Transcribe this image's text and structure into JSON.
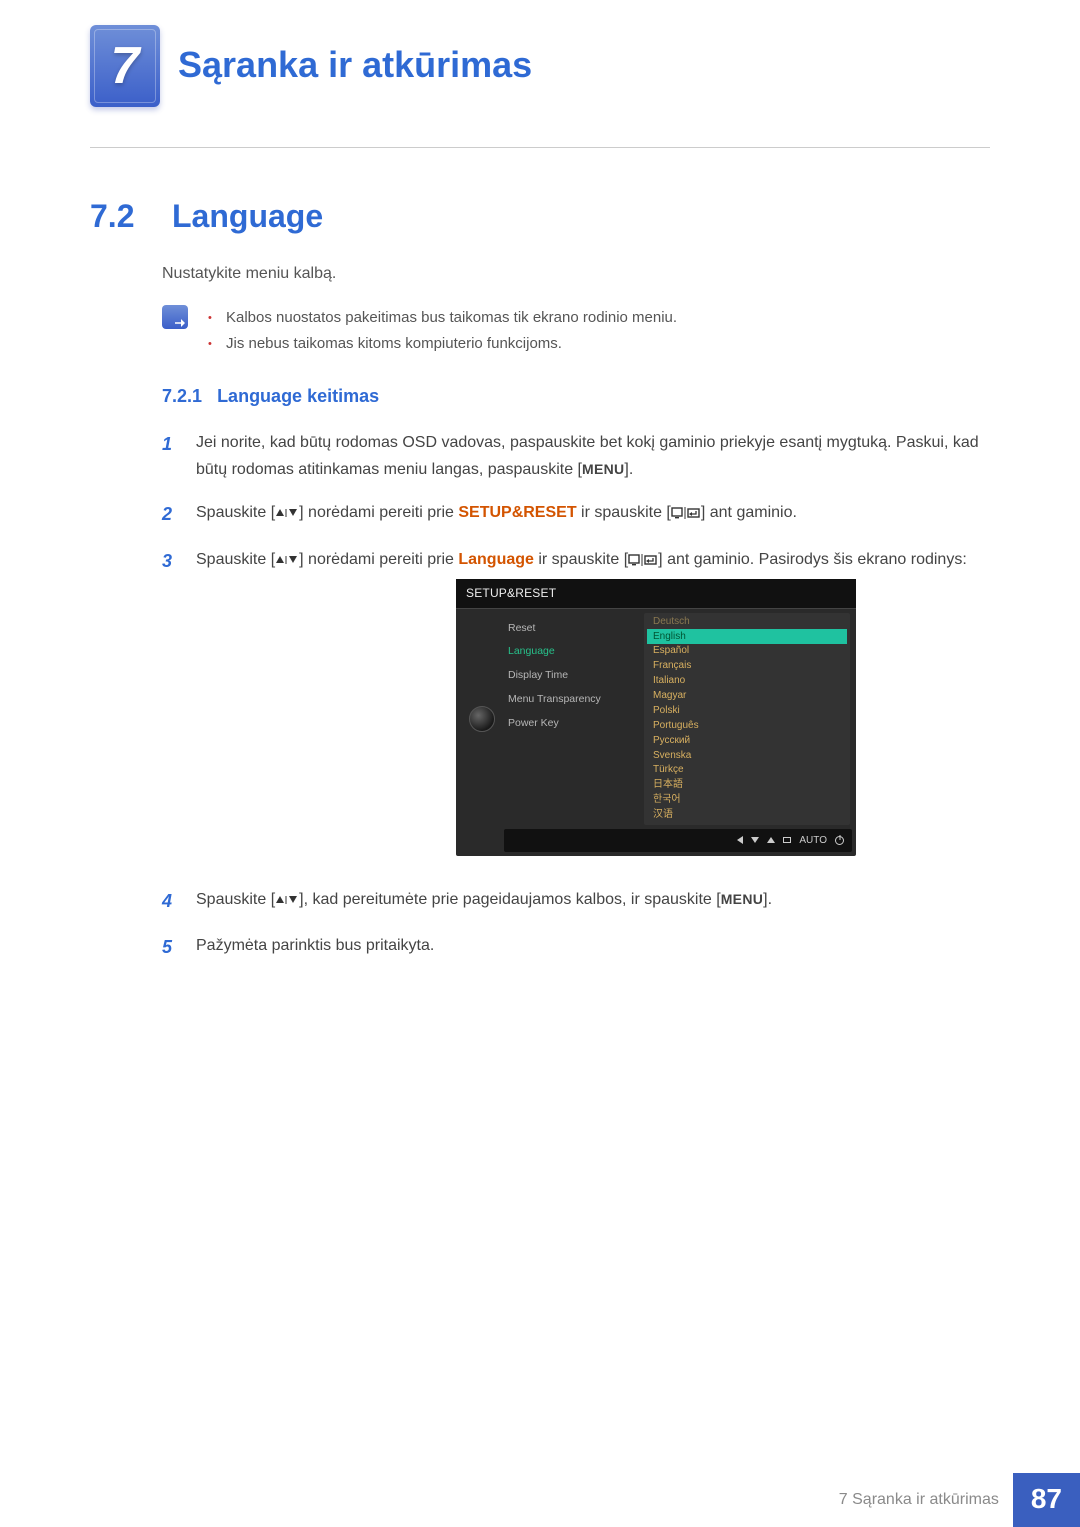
{
  "chapter": {
    "number": "7",
    "title": "Sąranka ir atkūrimas"
  },
  "section": {
    "number": "7.2",
    "title": "Language"
  },
  "intro": "Nustatykite meniu kalbą.",
  "notes": [
    "Kalbos nuostatos pakeitimas bus taikomas tik ekrano rodinio meniu.",
    "Jis nebus taikomas kitoms kompiuterio funkcijoms."
  ],
  "subsection": {
    "number": "7.2.1",
    "title": "Language keitimas"
  },
  "steps": {
    "s1a": "Jei norite, kad būtų rodomas OSD vadovas, paspauskite bet kokį gaminio priekyje esantį mygtuką. Paskui, kad būtų rodomas atitinkamas meniu langas, paspauskite [",
    "s1b": "].",
    "s2a": "Spauskite [",
    "s2b": "] norėdami pereiti prie ",
    "s2c": " ir spauskite [",
    "s2d": "] ant gaminio.",
    "s3a": "Spauskite [",
    "s3b": "] norėdami pereiti prie ",
    "s3c": " ir spauskite [",
    "s3d": "] ant gaminio. Pasirodys šis ekrano rodinys:",
    "s4a": "Spauskite [",
    "s4b": "], kad pereitumėte prie pageidaujamos kalbos, ir spauskite [",
    "s4c": "].",
    "s5": "Pažymėta parinktis bus pritaikyta."
  },
  "kw": {
    "setupreset": "SETUP&RESET",
    "language": "Language",
    "menu": "MENU"
  },
  "osd": {
    "title": "SETUP&RESET",
    "left": [
      "Reset",
      "Language",
      "Display Time",
      "Menu Transparency",
      "Power Key"
    ],
    "left_selected_index": 1,
    "langs": [
      "Deutsch",
      "English",
      "Español",
      "Français",
      "Italiano",
      "Magyar",
      "Polski",
      "Português",
      "Русский",
      "Svenska",
      "Türkçe",
      "日本語",
      "한국어",
      "汉语"
    ],
    "lang_highlight_index": 1,
    "foot_auto": "AUTO"
  },
  "footer": {
    "label": "7 Sąranka ir atkūrimas",
    "page": "87"
  }
}
